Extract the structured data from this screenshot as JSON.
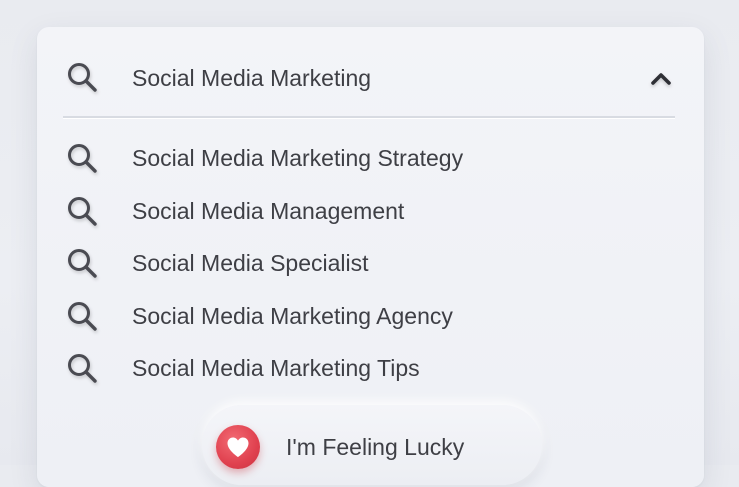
{
  "search": {
    "value": "Social Media Marketing",
    "icon": "search-icon",
    "toggle_icon": "chevron-up-icon"
  },
  "suggestions": [
    {
      "label": "Social Media Marketing Strategy",
      "icon": "search-icon"
    },
    {
      "label": "Social Media Management",
      "icon": "search-icon"
    },
    {
      "label": "Social Media Specialist",
      "icon": "search-icon"
    },
    {
      "label": "Social Media Marketing Agency",
      "icon": "search-icon"
    },
    {
      "label": "Social Media Marketing Tips",
      "icon": "search-icon"
    }
  ],
  "lucky_button": {
    "label": "I'm Feeling Lucky",
    "icon": "heart-icon"
  },
  "colors": {
    "text": "#3e3f45",
    "icon": "#4a4b52",
    "accent": "#e0414f",
    "card": "#f1f2f6",
    "background": "#e9ebf0"
  }
}
